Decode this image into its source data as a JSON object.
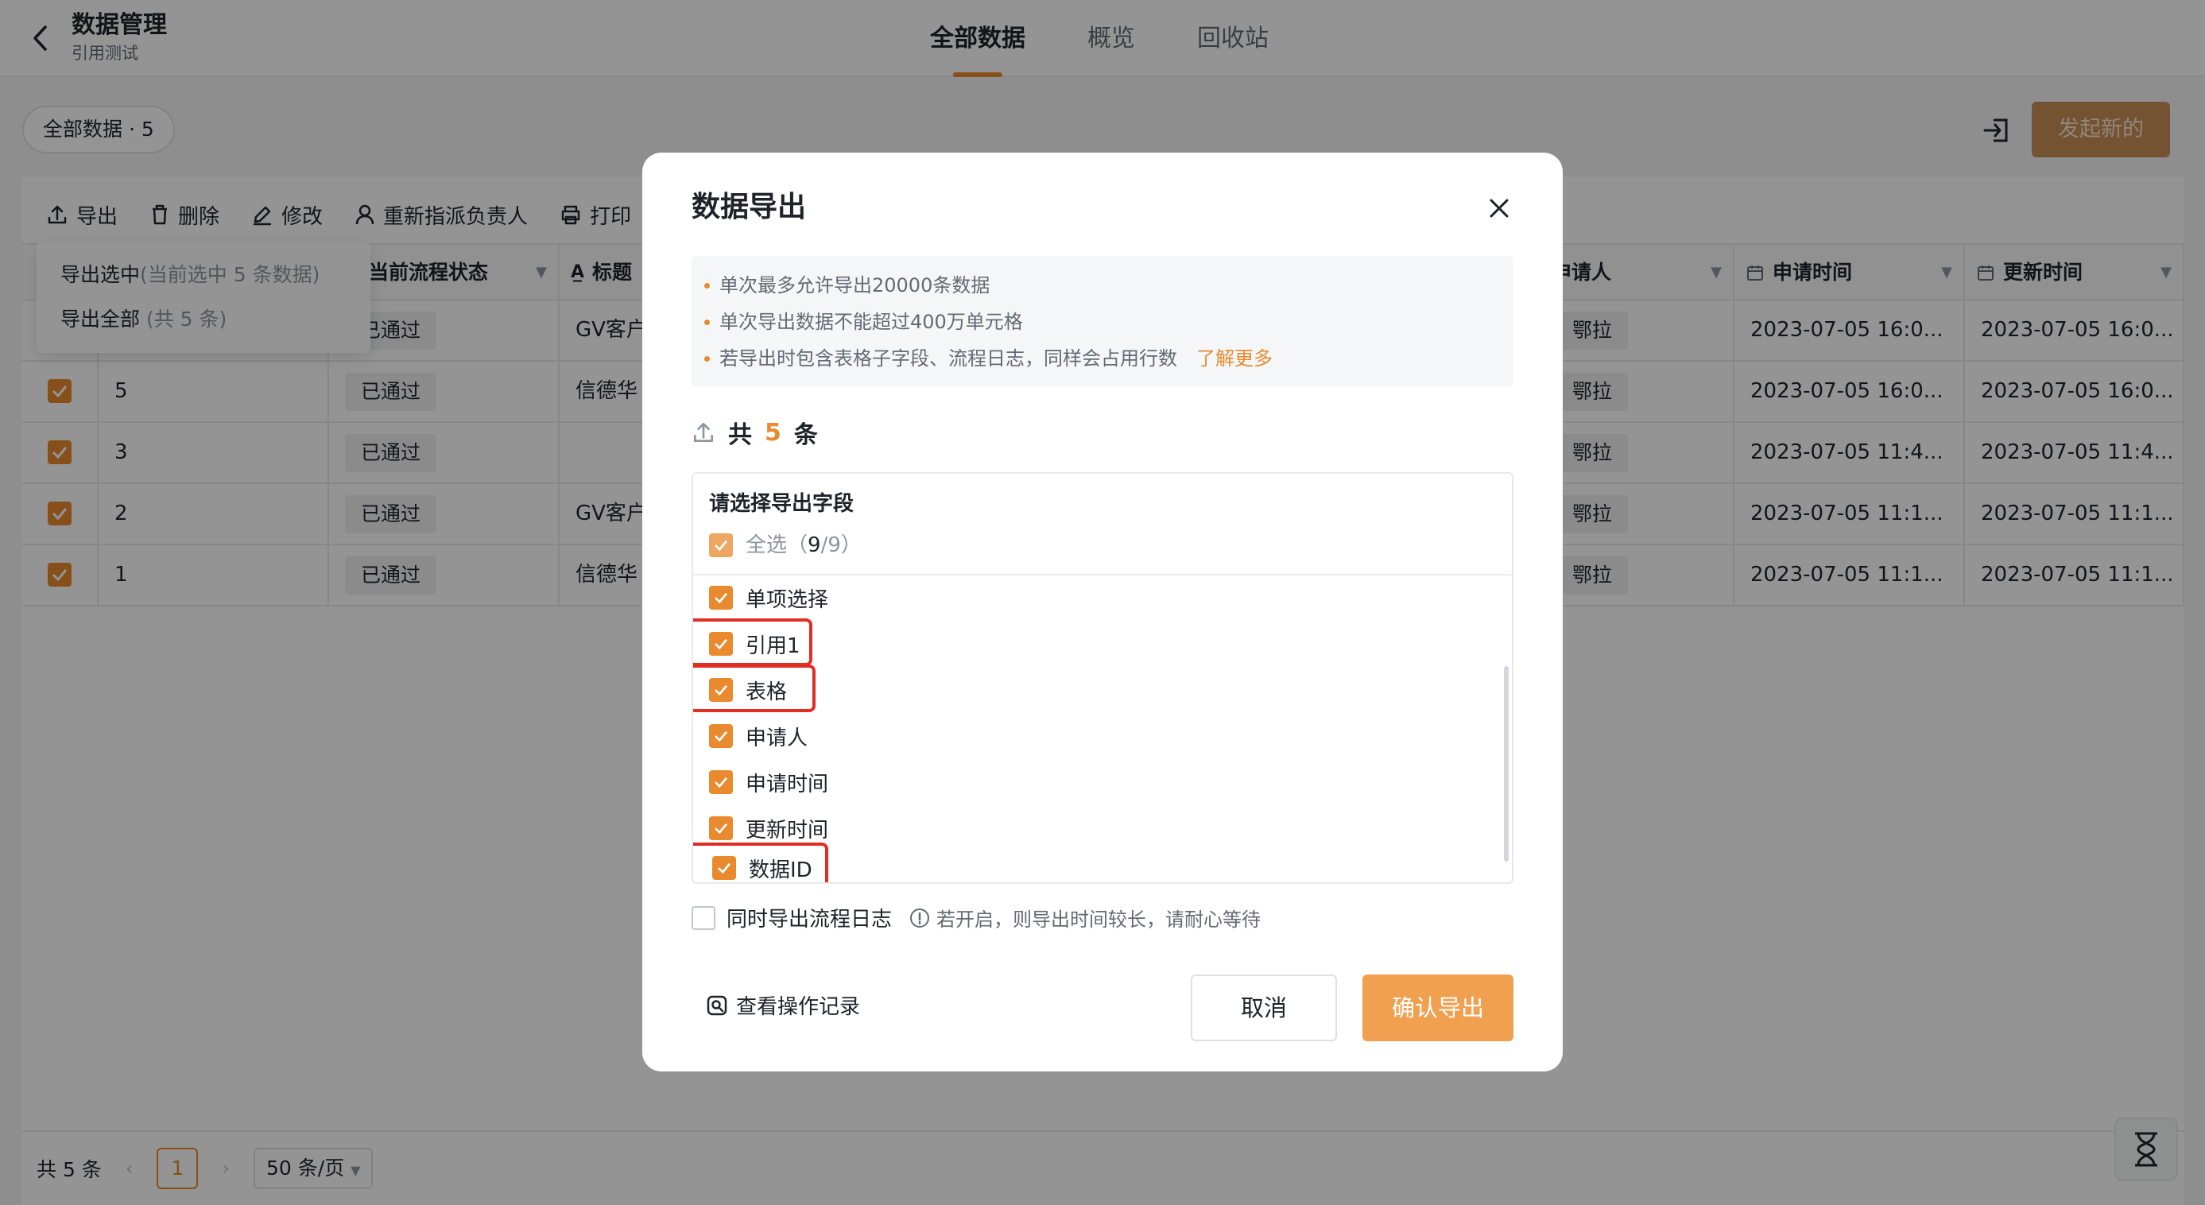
{
  "header": {
    "title": "数据管理",
    "subtitle": "引用测试",
    "tabs": [
      {
        "label": "全部数据",
        "active": true
      },
      {
        "label": "概览",
        "active": false
      },
      {
        "label": "回收站",
        "active": false
      }
    ]
  },
  "toolbar": {
    "filter_label": "全部数据 · 5",
    "primary_button": "发起新的",
    "actions": [
      {
        "label": "导出",
        "icon": "upload-icon"
      },
      {
        "label": "删除",
        "icon": "trash-icon"
      },
      {
        "label": "修改",
        "icon": "edit-icon"
      },
      {
        "label": "重新指派负责人",
        "icon": "user-icon"
      },
      {
        "label": "打印",
        "icon": "printer-icon"
      }
    ],
    "export_menu": {
      "selected_label": "导出选中",
      "selected_hint": "(当前选中 5 条数据)",
      "all_label": "导出全部",
      "all_hint": "(共 5 条)"
    }
  },
  "table": {
    "columns": [
      "当前流程状态",
      "标题",
      "申请人",
      "申请时间",
      "更新时间"
    ],
    "rows": [
      {
        "id": "",
        "status": "已通过",
        "title": "GV客户",
        "applicant": "鄂拉",
        "created": "2023-07-05 16:0...",
        "updated": "2023-07-05 16:0..."
      },
      {
        "id": "5",
        "status": "已通过",
        "title": "信德华",
        "applicant": "鄂拉",
        "created": "2023-07-05 16:0...",
        "updated": "2023-07-05 16:0..."
      },
      {
        "id": "3",
        "status": "已通过",
        "title": "",
        "applicant": "鄂拉",
        "created": "2023-07-05 11:4...",
        "updated": "2023-07-05 11:4..."
      },
      {
        "id": "2",
        "status": "已通过",
        "title": "GV客户",
        "applicant": "鄂拉",
        "created": "2023-07-05 11:1...",
        "updated": "2023-07-05 11:1..."
      },
      {
        "id": "1",
        "status": "已通过",
        "title": "信德华",
        "applicant": "鄂拉",
        "created": "2023-07-05 11:1...",
        "updated": "2023-07-05 11:1..."
      }
    ]
  },
  "pagination": {
    "total": "共 5 条",
    "current_page": "1",
    "page_size": "50 条/页"
  },
  "modal": {
    "title": "数据导出",
    "notices": [
      "单次最多允许导出20000条数据",
      "单次导出数据不能超过400万单元格",
      "若导出时包含表格子字段、流程日志，同样会占用行数"
    ],
    "learn_more": "了解更多",
    "count_prefix": "共",
    "count_value": "5",
    "count_suffix": "条",
    "field_section_title": "请选择导出字段",
    "select_all_label": "全选（",
    "select_all_count": "9",
    "select_all_total": "/9）",
    "fields": [
      {
        "label": "单项选择",
        "checked": true,
        "highlighted": false
      },
      {
        "label": "引用1",
        "checked": true,
        "highlighted": true
      },
      {
        "label": "表格",
        "checked": true,
        "highlighted": true
      },
      {
        "label": "申请人",
        "checked": true,
        "highlighted": false
      },
      {
        "label": "申请时间",
        "checked": true,
        "highlighted": false
      },
      {
        "label": "更新时间",
        "checked": true,
        "highlighted": false
      },
      {
        "label": "数据ID",
        "checked": true,
        "highlighted": true
      }
    ],
    "log_option_label": "同时导出流程日志",
    "log_option_checked": false,
    "log_hint": "若开启，则导出时间较长，请耐心等待",
    "history_link": "查看操作记录",
    "cancel_label": "取消",
    "confirm_label": "确认导出"
  },
  "colors": {
    "accent": "#e98a2f",
    "highlight_box": "#e02e24"
  }
}
